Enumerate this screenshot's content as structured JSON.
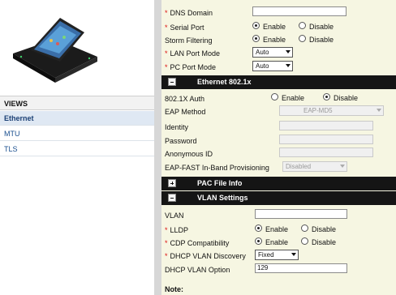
{
  "sidebar": {
    "views_header": "VIEWS",
    "items": [
      {
        "label": "Ethernet",
        "active": true
      },
      {
        "label": "MTU",
        "active": false
      },
      {
        "label": "TLS",
        "active": false
      }
    ]
  },
  "form": {
    "dns_domain": {
      "label": "DNS Domain",
      "value": ""
    },
    "serial_port": {
      "label": "Serial Port",
      "enable": "Enable",
      "disable": "Disable",
      "selected": "Enable"
    },
    "storm_filtering": {
      "label": "Storm Filtering",
      "enable": "Enable",
      "disable": "Disable",
      "selected": "Enable"
    },
    "lan_port_mode": {
      "label": "LAN Port Mode",
      "value": "Auto"
    },
    "pc_port_mode": {
      "label": "PC Port Mode",
      "value": "Auto"
    }
  },
  "ethernet_8021x": {
    "title": "Ethernet 802.1x",
    "auth": {
      "label": "802.1X Auth",
      "enable": "Enable",
      "disable": "Disable",
      "selected": "Disable"
    },
    "eap_method": {
      "label": "EAP Method",
      "value": "EAP-MD5"
    },
    "identity": {
      "label": "Identity",
      "value": ""
    },
    "password": {
      "label": "Password",
      "value": ""
    },
    "anonymous_id": {
      "label": "Anonymous ID",
      "value": ""
    },
    "eap_fast": {
      "label": "EAP-FAST In-Band Provisioning",
      "value": "Disabled"
    }
  },
  "pac_file": {
    "title": "PAC File Info"
  },
  "vlan_settings": {
    "title": "VLAN Settings",
    "vlan": {
      "label": "VLAN",
      "value": ""
    },
    "lldp": {
      "label": "LLDP",
      "enable": "Enable",
      "disable": "Disable",
      "selected": "Enable"
    },
    "cdp": {
      "label": "CDP Compatibility",
      "enable": "Enable",
      "disable": "Disable",
      "selected": "Enable"
    },
    "dhcp_vlan_discovery": {
      "label": "DHCP VLAN Discovery",
      "value": "Fixed"
    },
    "dhcp_vlan_option": {
      "label": "DHCP VLAN Option",
      "value": "129"
    }
  },
  "note": "Note:",
  "colors": {
    "section_bg": "#151515",
    "form_bg": "#f6f6e2",
    "active_nav": "#dfe8f3",
    "required": "#dd1111"
  }
}
